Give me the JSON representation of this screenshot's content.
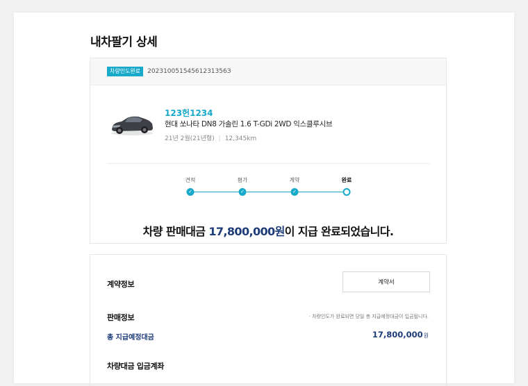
{
  "page": {
    "title": "내차팔기 상세"
  },
  "order": {
    "status_badge": "차량인도완료",
    "order_number": "20231005154561231356З"
  },
  "vehicle": {
    "plate": "123헌1234",
    "model": "현대 쏘나타 DN8 가솔린 1.6 T-GDi 2WD 익스클루시브",
    "year": "21년 2월(21년형)",
    "mileage": "12,345km"
  },
  "steps": [
    {
      "label": "견적",
      "state": "done"
    },
    {
      "label": "평가",
      "state": "done"
    },
    {
      "label": "계약",
      "state": "done"
    },
    {
      "label": "완료",
      "state": "current"
    }
  ],
  "completion": {
    "prefix": "차량 판매대금 ",
    "amount": "17,800,000원",
    "suffix": "이 지급 완료되었습니다."
  },
  "contract": {
    "title": "계약정보",
    "button_label": "계약서"
  },
  "sale": {
    "title": "판매정보",
    "note": "· 차량인도가 완료되면 당일 총 지급예정대금이 입금됩니다.",
    "total_label": "총 지급예정대금",
    "total_value": "17,800,000",
    "total_unit": "원"
  },
  "deposit": {
    "title": "차량대금 입금계좌"
  },
  "colors": {
    "accent": "#16a9c9",
    "navy": "#1d3c78"
  },
  "icons": {
    "check": "check-icon",
    "car": "car-image"
  }
}
